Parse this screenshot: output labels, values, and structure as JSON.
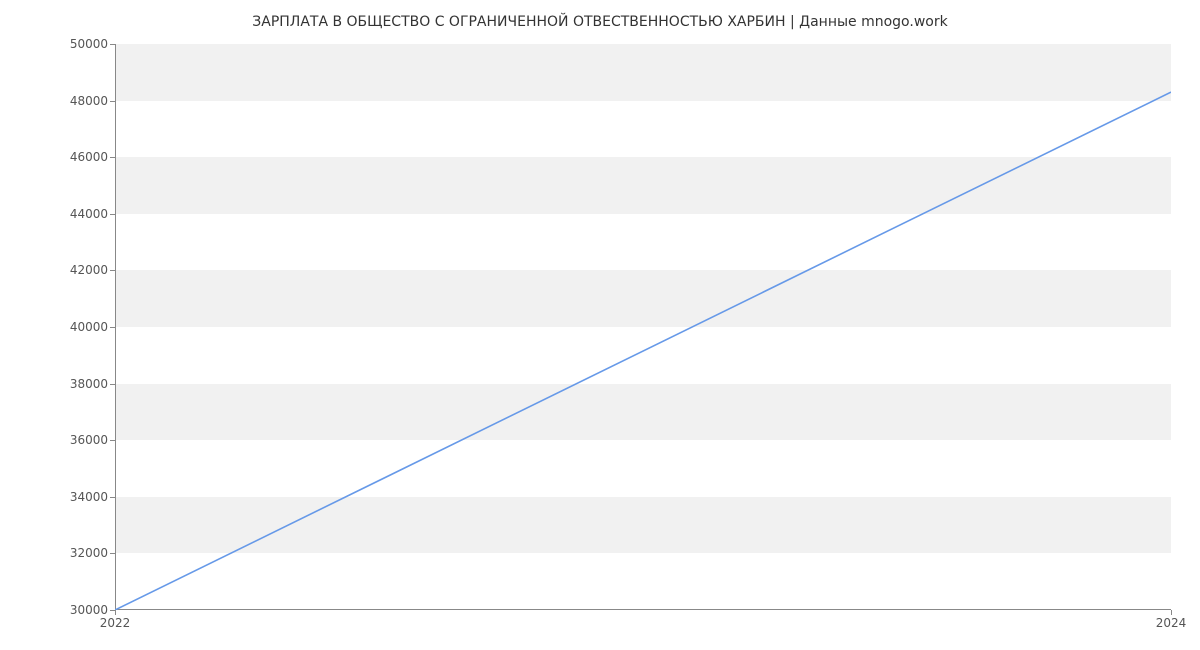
{
  "chart_data": {
    "type": "line",
    "title": "ЗАРПЛАТА В ОБЩЕСТВО С ОГРАНИЧЕННОЙ ОТВЕСТВЕННОСТЬЮ ХАРБИН | Данные mnogo.work",
    "xlabel": "",
    "ylabel": "",
    "x": [
      2022,
      2024
    ],
    "values": [
      30000,
      48300
    ],
    "x_ticks": [
      2022,
      2024
    ],
    "y_ticks": [
      30000,
      32000,
      34000,
      36000,
      38000,
      40000,
      42000,
      44000,
      46000,
      48000,
      50000
    ],
    "xlim": [
      2022,
      2024
    ],
    "ylim": [
      30000,
      50000
    ],
    "line_color": "#6699e8",
    "band_color": "#f1f1f1"
  }
}
